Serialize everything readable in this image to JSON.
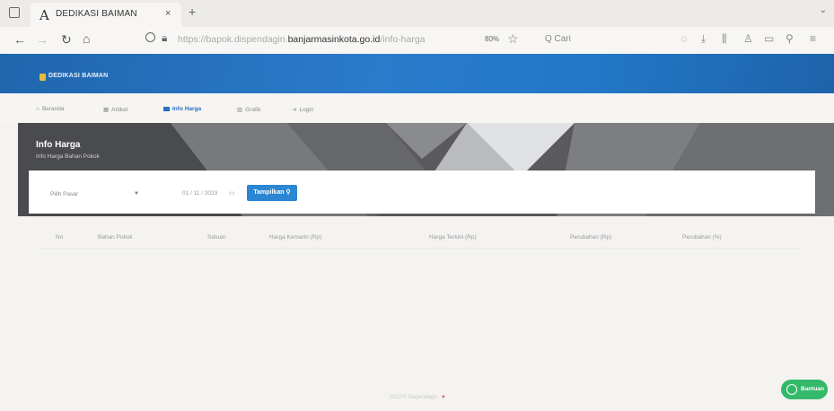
{
  "browser": {
    "tab_favicon": "A",
    "tab_title": "DEDIKASI BAIMAN",
    "tab_close": "×",
    "new_tab": "+",
    "window_chevron": "⌄",
    "url_prefix": "https://bapok.dispendagin.",
    "url_host": "banjarmasinkota.go.id",
    "url_suffix": "/info-harga",
    "zoom": "80%",
    "search_label": "Q Cari",
    "icons": [
      "pocket-icon",
      "download-icon",
      "library-icon",
      "account-icon",
      "sidebar-icon",
      "extensions-icon",
      "menu-icon"
    ]
  },
  "site": {
    "brand": "DEDIKASI BAIMAN",
    "accent": "#2b7bcb",
    "menu": [
      {
        "icon": "home-icon",
        "label": "Beranda"
      },
      {
        "icon": "article-icon",
        "label": "Artikel"
      },
      {
        "icon": "price-icon",
        "label": "Info Harga",
        "active": true
      },
      {
        "icon": "chart-icon",
        "label": "Grafik"
      },
      {
        "icon": "login-icon",
        "label": "Login"
      }
    ]
  },
  "hero": {
    "title": "Info Harga",
    "subtitle": "Info Harga Bahan Pokok"
  },
  "filter": {
    "market_placeholder": "Pilih Pasar",
    "date_value": "01 / 11 / 2023",
    "show_button": "Tampilkan"
  },
  "table": {
    "headers": [
      "No",
      "Bahan Pokok",
      "Satuan",
      "Harga Kemarin (Rp)",
      "Harga Terkini (Rp)",
      "Perubahan (Rp)",
      "Perubahan (%)"
    ]
  },
  "footer": {
    "text": "2023 © Dispendagin",
    "heart": "♥"
  },
  "whatsapp": {
    "label": "Bantuan"
  }
}
